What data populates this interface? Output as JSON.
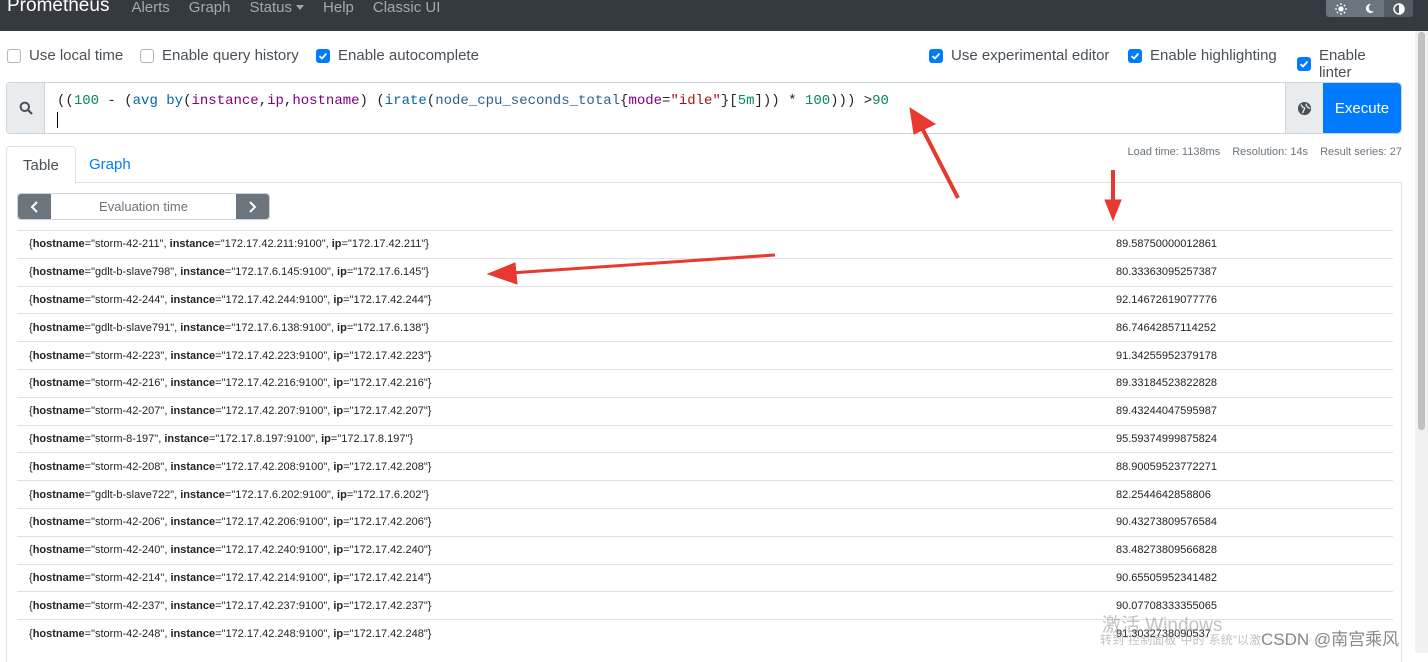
{
  "navbar": {
    "brand": "Prometheus",
    "items": [
      "Alerts",
      "Graph",
      "Status",
      "Help",
      "Classic UI"
    ]
  },
  "options": {
    "use_local_time": {
      "label": "Use local time",
      "checked": false
    },
    "query_history": {
      "label": "Enable query history",
      "checked": false
    },
    "autocomplete": {
      "label": "Enable autocomplete",
      "checked": true
    },
    "experimental_editor": {
      "label": "Use experimental editor",
      "checked": true
    },
    "highlighting": {
      "label": "Enable highlighting",
      "checked": true
    },
    "linter": {
      "label": "Enable linter",
      "checked": true
    }
  },
  "expression": {
    "p1": "((",
    "p2": "100",
    "p3": " - (",
    "p4": "avg",
    "p5": " ",
    "p6": "by",
    "p7": "(",
    "p8": "instance",
    "p9": ",",
    "p10": "ip",
    "p11": ",",
    "p12": "hostname",
    "p13": ") (",
    "p14": "irate",
    "p15": "(",
    "p16": "node_cpu_seconds_total",
    "p17": "{",
    "p18": "mode",
    "p19": "=",
    "p20": "\"idle\"",
    "p21": "}[",
    "p22": "5m",
    "p23": "])) * ",
    "p24": "100",
    "p25": "))) >",
    "p26": "90"
  },
  "execute_label": "Execute",
  "tabs": {
    "table": "Table",
    "graph": "Graph"
  },
  "stats": {
    "load_time": "Load time: 1138ms",
    "resolution": "Resolution: 14s",
    "result_series": "Result series: 27"
  },
  "eval_time_placeholder": "Evaluation time",
  "results": [
    {
      "hostname": "storm-42-211",
      "instance": "172.17.42.211:9100",
      "ip": "172.17.42.211",
      "value": "89.58750000012861"
    },
    {
      "hostname": "gdlt-b-slave798",
      "instance": "172.17.6.145:9100",
      "ip": "172.17.6.145",
      "value": "80.33363095257387"
    },
    {
      "hostname": "storm-42-244",
      "instance": "172.17.42.244:9100",
      "ip": "172.17.42.244",
      "value": "92.14672619077776"
    },
    {
      "hostname": "gdlt-b-slave791",
      "instance": "172.17.6.138:9100",
      "ip": "172.17.6.138",
      "value": "86.74642857114252"
    },
    {
      "hostname": "storm-42-223",
      "instance": "172.17.42.223:9100",
      "ip": "172.17.42.223",
      "value": "91.34255952379178"
    },
    {
      "hostname": "storm-42-216",
      "instance": "172.17.42.216:9100",
      "ip": "172.17.42.216",
      "value": "89.33184523822828"
    },
    {
      "hostname": "storm-42-207",
      "instance": "172.17.42.207:9100",
      "ip": "172.17.42.207",
      "value": "89.43244047595987"
    },
    {
      "hostname": "storm-8-197",
      "instance": "172.17.8.197:9100",
      "ip": "172.17.8.197",
      "value": "95.59374999875824"
    },
    {
      "hostname": "storm-42-208",
      "instance": "172.17.42.208:9100",
      "ip": "172.17.42.208",
      "value": "88.90059523772271"
    },
    {
      "hostname": "gdlt-b-slave722",
      "instance": "172.17.6.202:9100",
      "ip": "172.17.6.202",
      "value": "82.2544642858806"
    },
    {
      "hostname": "storm-42-206",
      "instance": "172.17.42.206:9100",
      "ip": "172.17.42.206",
      "value": "90.43273809576584"
    },
    {
      "hostname": "storm-42-240",
      "instance": "172.17.42.240:9100",
      "ip": "172.17.42.240",
      "value": "83.48273809566828"
    },
    {
      "hostname": "storm-42-214",
      "instance": "172.17.42.214:9100",
      "ip": "172.17.42.214",
      "value": "90.65505952341482"
    },
    {
      "hostname": "storm-42-237",
      "instance": "172.17.42.237:9100",
      "ip": "172.17.42.237",
      "value": "90.07708333355065"
    },
    {
      "hostname": "storm-42-248",
      "instance": "172.17.42.248:9100",
      "ip": "172.17.42.248",
      "value": "91.3032738090537"
    }
  ],
  "watermark": {
    "line1": "激活 Windows",
    "line2": "转到\"控制面板\"中的\"系统\"以激活 Windows。",
    "csdn": "CSDN @南宫乘风"
  },
  "colors": {
    "navbar": "#343a40",
    "primary": "#007bff",
    "annotation_arrow": "#e8382f"
  }
}
